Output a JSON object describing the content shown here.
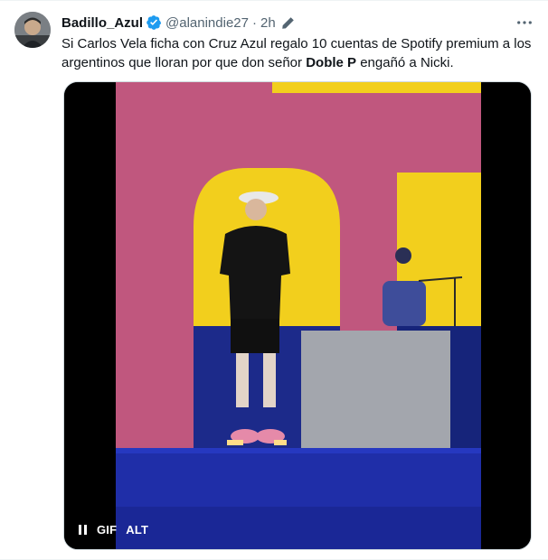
{
  "author": {
    "display_name": "Badillo_Azul",
    "handle": "@alanindie27",
    "separator": "·",
    "timestamp": "2h"
  },
  "tweet": {
    "text_part1": "Si Carlos Vela ficha con Cruz Azul regalo 10 cuentas de Spotify premium a los argentinos que lloran por que don señor ",
    "text_bold": "Doble P",
    "text_part2": " engañó a Nicki."
  },
  "media": {
    "gif_label": "GIF",
    "alt_label": "ALT"
  },
  "colors": {
    "verified": "#1d9bf0",
    "secondary_text": "#536471",
    "stage_pink": "#c0577e",
    "stage_yellow": "#f2cf1d",
    "stage_blue": "#1c2a8a"
  },
  "icons": {
    "verified": "verified-badge-icon",
    "edited": "pencil-icon",
    "more": "more-horizontal-icon",
    "pause": "pause-icon"
  }
}
